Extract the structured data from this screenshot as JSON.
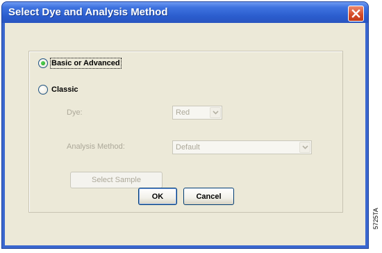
{
  "window": {
    "title": "Select Dye and Analysis Method",
    "close_icon": "close-icon",
    "accent_color": "#3a67cf",
    "close_color": "#d44a26"
  },
  "options": {
    "basic_label": "Basic or Advanced",
    "basic_selected": true,
    "classic_label": "Classic",
    "classic_selected": false
  },
  "classic_settings": {
    "dye_label": "Dye:",
    "dye_value": "Red",
    "analysis_label": "Analysis Method:",
    "analysis_value": "Default",
    "select_sample_label": "Select Sample"
  },
  "buttons": {
    "ok_label": "OK",
    "cancel_label": "Cancel"
  },
  "figure_code": "5725TA"
}
